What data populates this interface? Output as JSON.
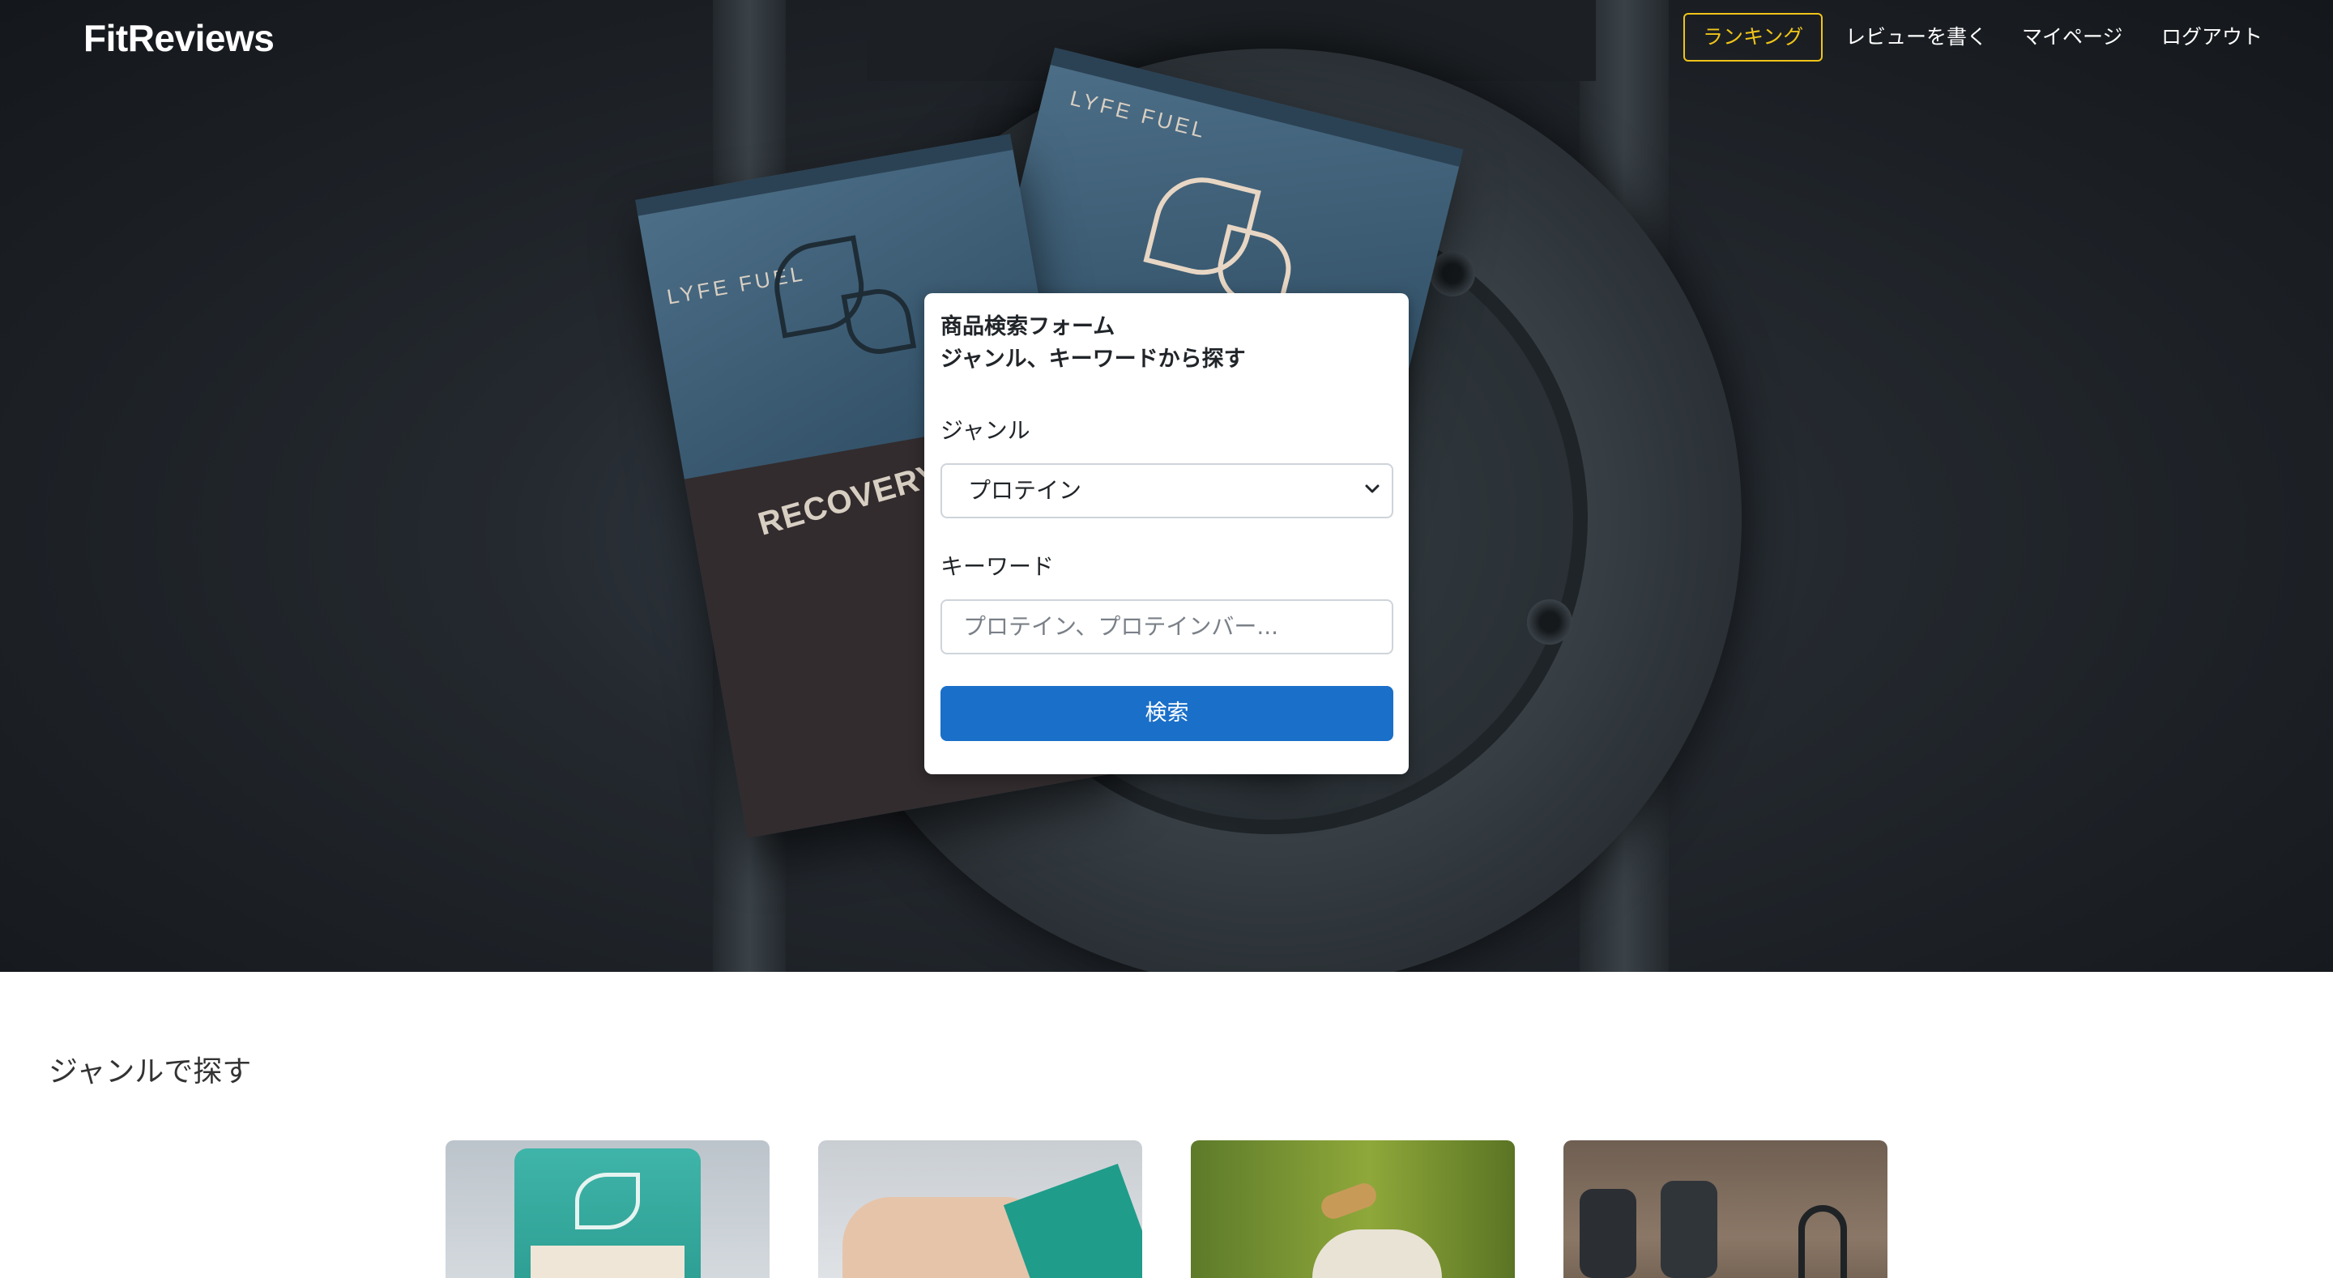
{
  "nav": {
    "brand": "FitReviews",
    "items": [
      {
        "label": "ランキング",
        "active": true
      },
      {
        "label": "レビューを書く",
        "active": false
      },
      {
        "label": "マイページ",
        "active": false
      },
      {
        "label": "ログアウト",
        "active": false
      }
    ]
  },
  "hero_image": {
    "pouch_brand": "LYFE FUEL",
    "pouch_text": "RECOVERY SHAKE"
  },
  "search_form": {
    "title_line1": "商品検索フォーム",
    "title_line2": "ジャンル、キーワードから探す",
    "genre_label": "ジャンル",
    "genre_selected": "プロテイン",
    "keyword_label": "キーワード",
    "keyword_placeholder": "プロテイン、プロテインバー...",
    "keyword_value": "",
    "submit_label": "検索"
  },
  "genre_section": {
    "title": "ジャンルで探す",
    "cards": [
      {
        "image": "protein-shake-pouch-photo"
      },
      {
        "image": "protein-bar-photo"
      },
      {
        "image": "supplement-jar-photo"
      },
      {
        "image": "dumbbells-photo"
      }
    ]
  },
  "colors": {
    "active_nav": "#f0c419",
    "primary_button": "#1a6fc9"
  }
}
